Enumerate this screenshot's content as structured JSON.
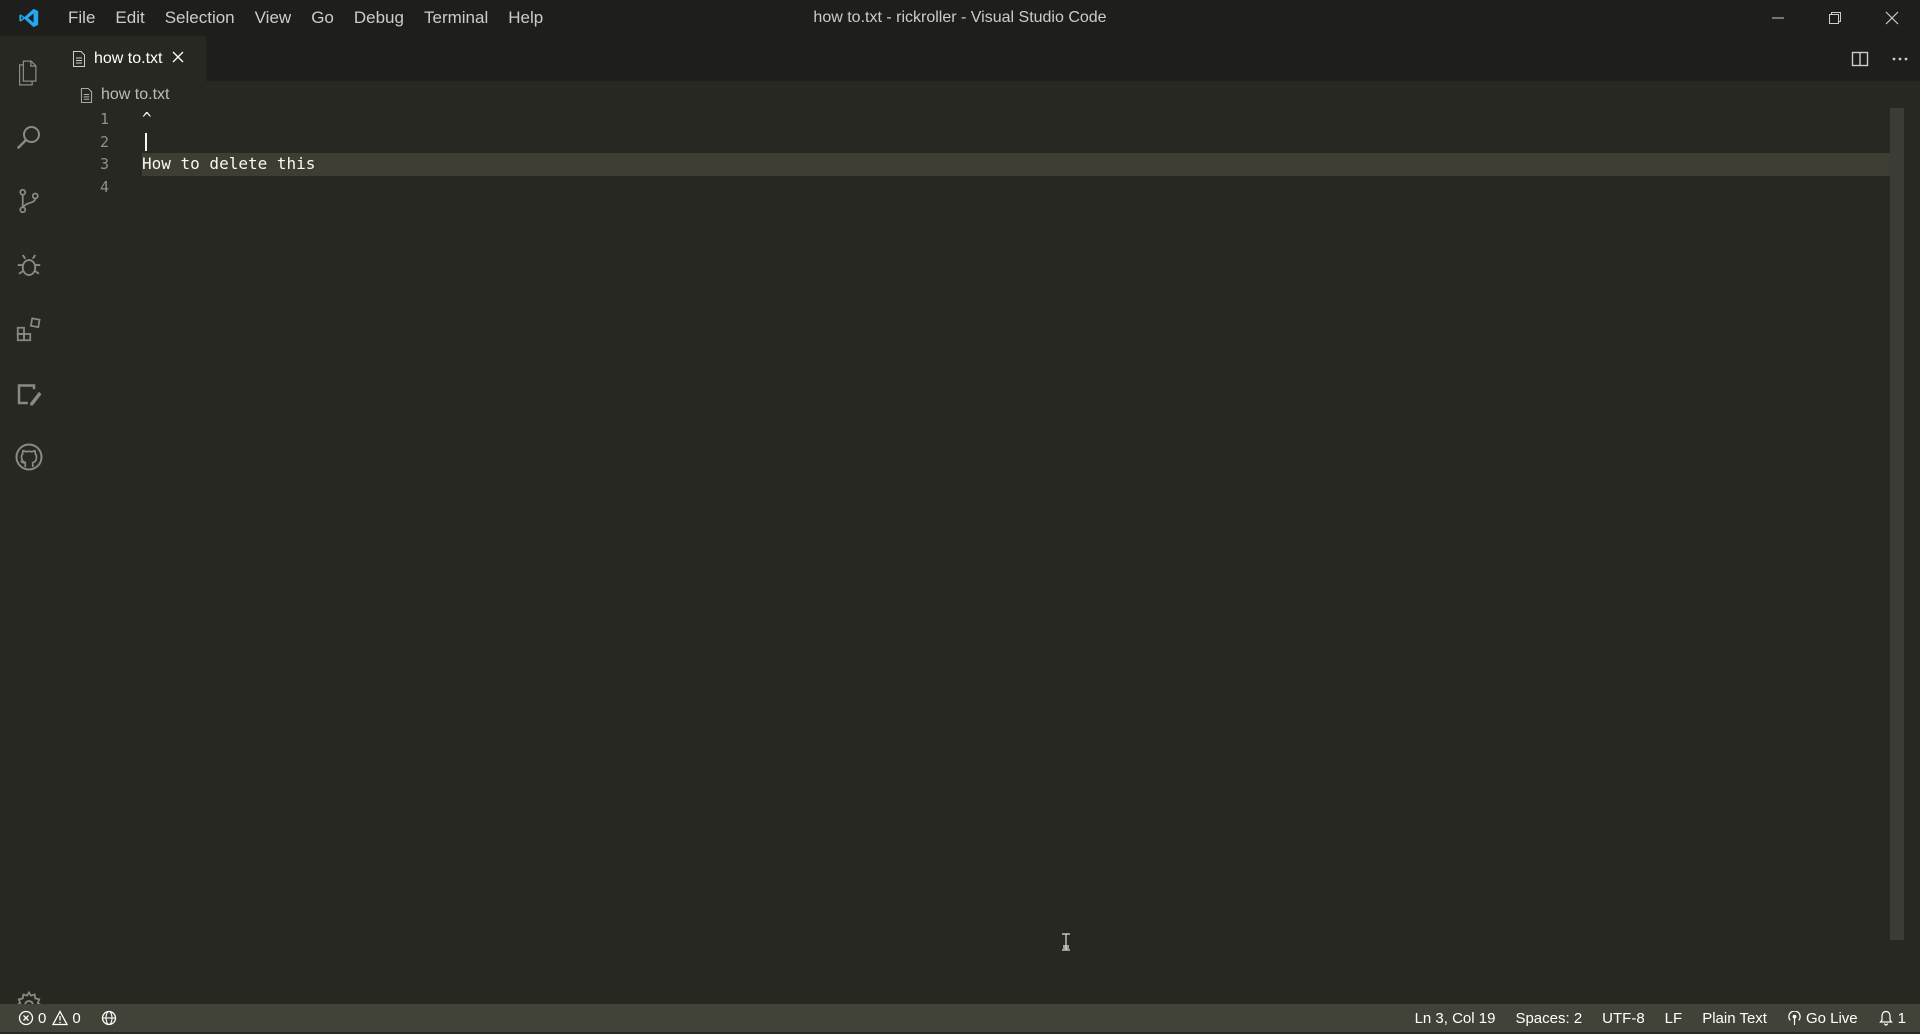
{
  "window": {
    "title": "how to.txt - rickroller - Visual Studio Code"
  },
  "menu": [
    "File",
    "Edit",
    "Selection",
    "View",
    "Go",
    "Debug",
    "Terminal",
    "Help"
  ],
  "activity_bar": {
    "items": [
      "explorer-icon",
      "search-icon",
      "source-control-icon",
      "debug-icon",
      "extensions-icon",
      "remote-explorer-icon",
      "github-icon"
    ],
    "bottom": "gear-icon"
  },
  "tabs": [
    {
      "label": "how to.txt",
      "active": true
    }
  ],
  "breadcrumb": {
    "file": "how to.txt"
  },
  "editor": {
    "line_numbers": [
      "1",
      "2",
      "3",
      "4"
    ],
    "lines": [
      "^",
      "",
      "How to delete this",
      ""
    ],
    "current_line": 3
  },
  "status_bar": {
    "errors": "0",
    "warnings": "0",
    "position": "Ln 3, Col 19",
    "spaces": "Spaces: 2",
    "encoding": "UTF-8",
    "eol": "LF",
    "language": "Plain Text",
    "go_live": "Go Live",
    "notifications": "1"
  },
  "colors": {
    "editor_bg": "#272822",
    "titlebar_bg": "#1e1f1c",
    "statusbar_bg": "#414339",
    "current_line_bg": "#3e3d32",
    "accent": "#0098ff"
  }
}
